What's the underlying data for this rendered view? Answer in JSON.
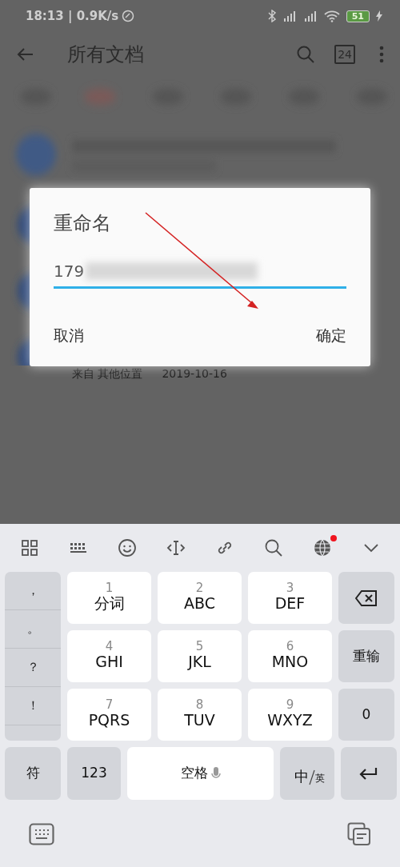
{
  "status_bar": {
    "time": "18:13 | 0.9K/s",
    "battery": "51"
  },
  "app_bar": {
    "title": "所有文档",
    "calendar_day": "24"
  },
  "list_item": {
    "source": "来自 其他位置",
    "date": "2019-10-16"
  },
  "dialog": {
    "title": "重命名",
    "field": {
      "value": "179"
    },
    "buttons": [
      {
        "label": "取消"
      },
      {
        "label": "确定"
      }
    ]
  },
  "keyboard": {
    "globe_notification": true,
    "punctuation": [
      "，",
      "。",
      "？",
      "！"
    ],
    "keys": [
      {
        "digit": "1",
        "letters": "分词"
      },
      {
        "digit": "2",
        "letters": "ABC"
      },
      {
        "digit": "3",
        "letters": "DEF"
      },
      {
        "digit": "4",
        "letters": "GHI"
      },
      {
        "digit": "5",
        "letters": "JKL"
      },
      {
        "digit": "6",
        "letters": "MNO"
      },
      {
        "digit": "7",
        "letters": "PQRS"
      },
      {
        "digit": "8",
        "letters": "TUV"
      },
      {
        "digit": "9",
        "letters": "WXYZ"
      }
    ],
    "side_keys": [
      {
        "kind": "backspace"
      },
      {
        "kind": "text",
        "label": "重输"
      },
      {
        "kind": "text",
        "label": "0"
      }
    ],
    "bottom_keys": [
      {
        "kind": "text",
        "label": "符"
      },
      {
        "kind": "text",
        "label": "123"
      },
      {
        "kind": "space",
        "label": "空格"
      },
      {
        "kind": "lang",
        "main": "中",
        "sub": "英"
      },
      {
        "kind": "enter"
      }
    ]
  }
}
